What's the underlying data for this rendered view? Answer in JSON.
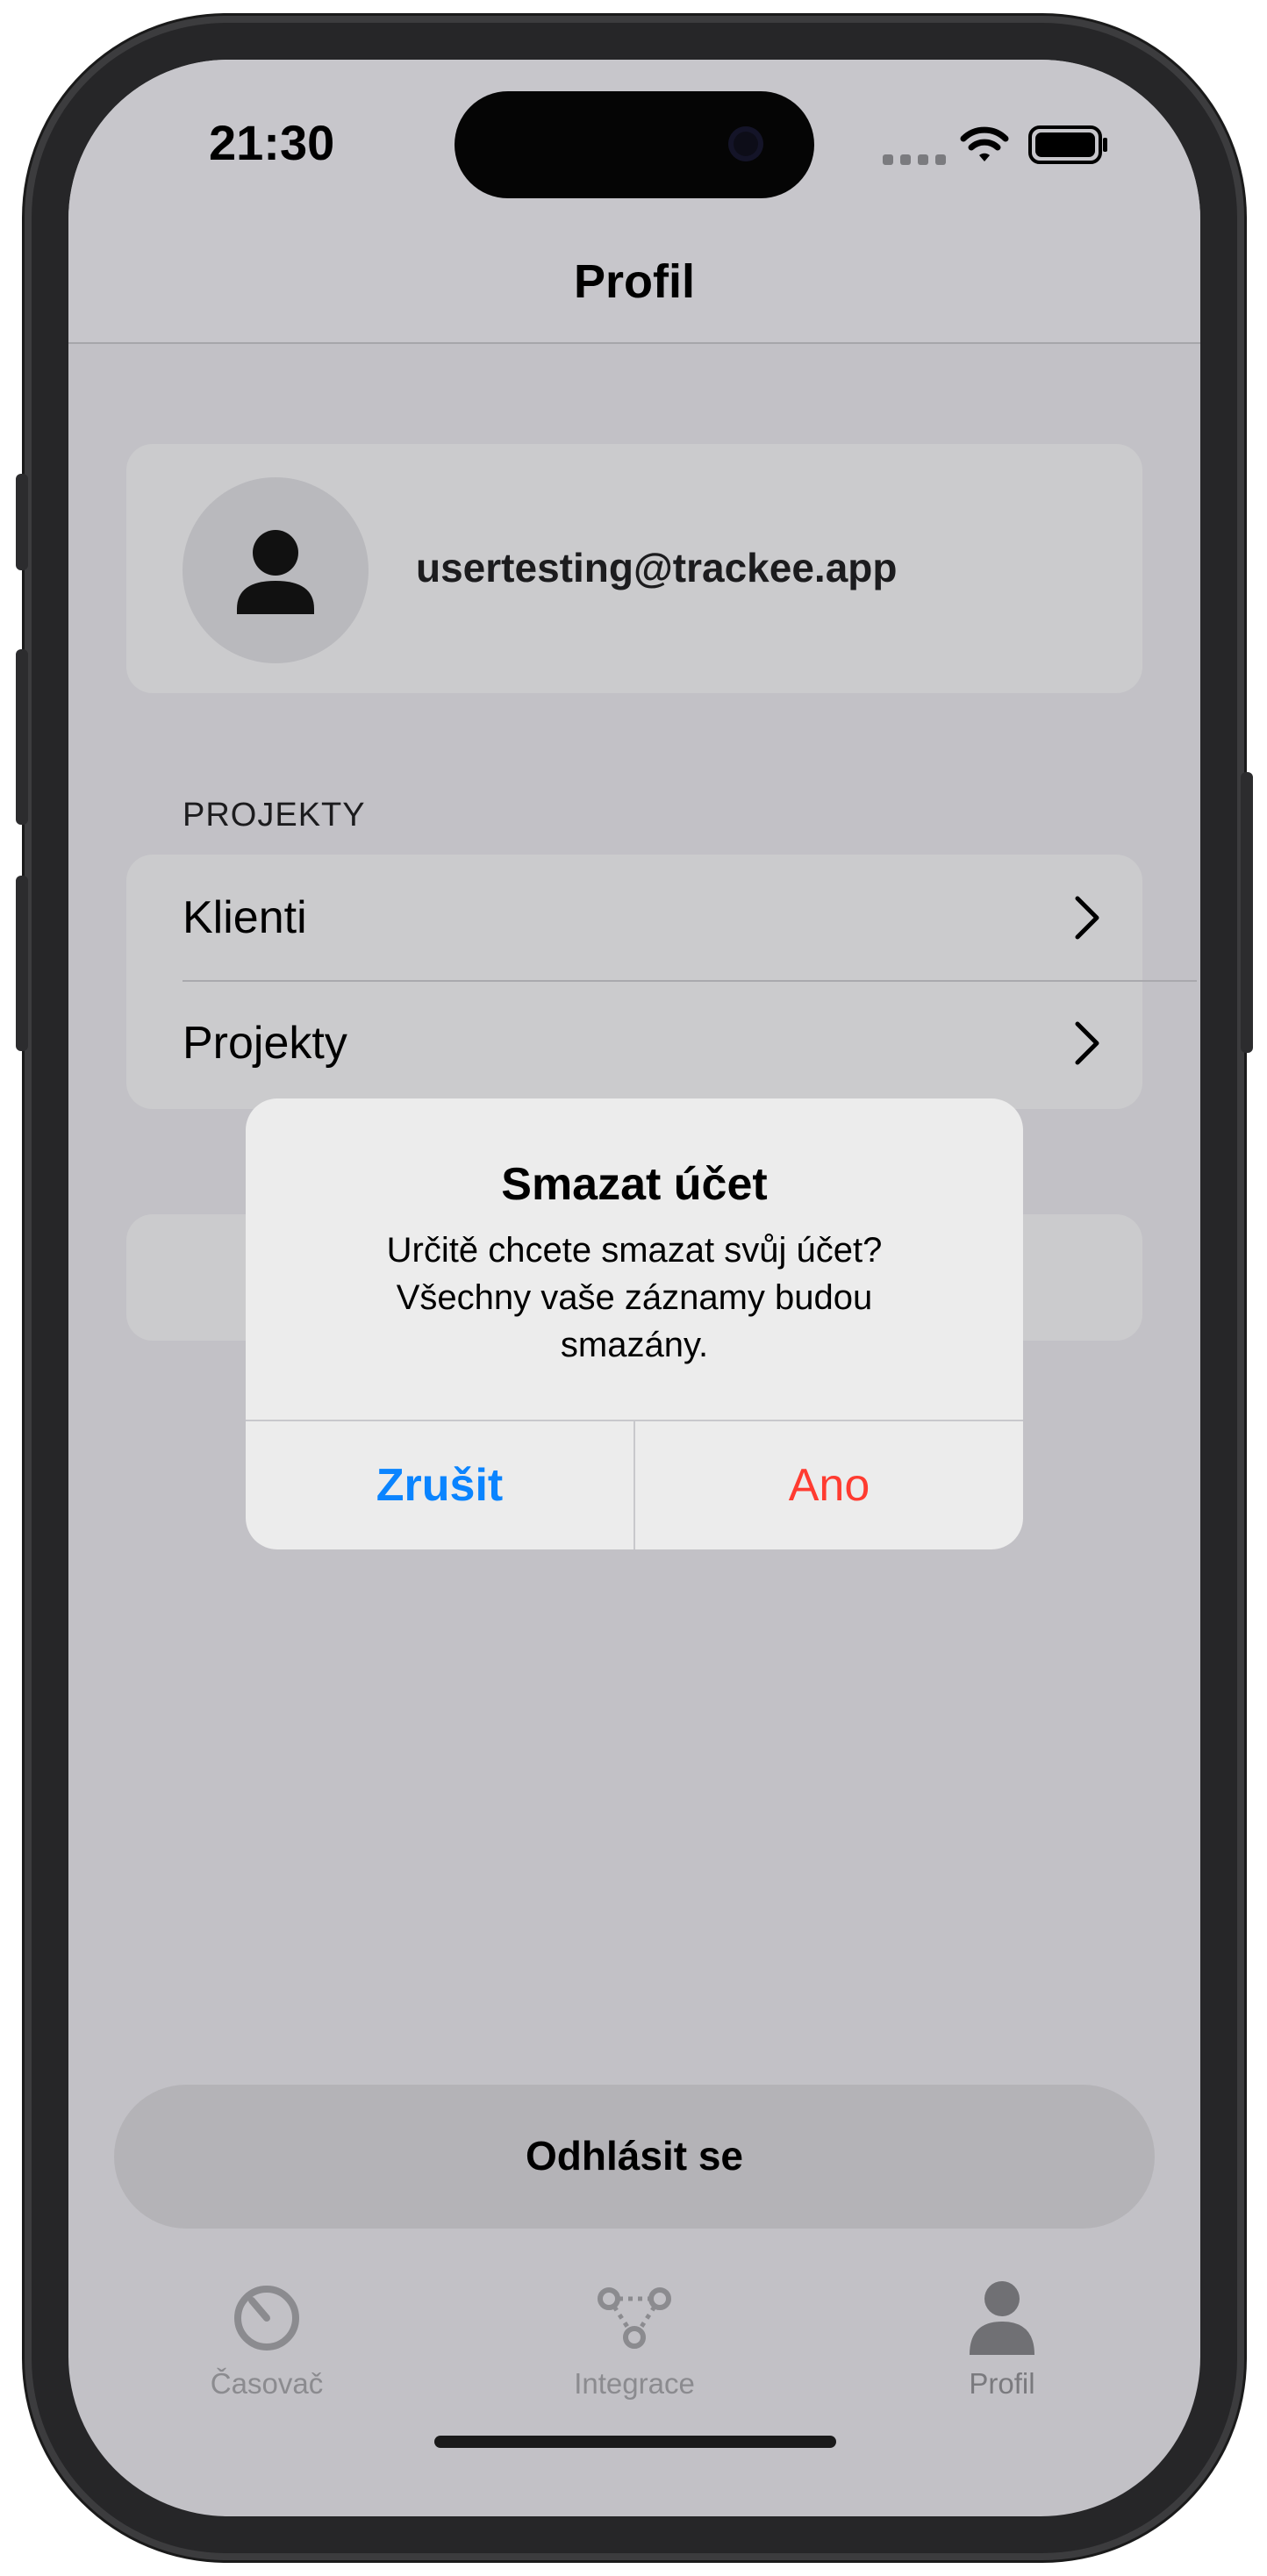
{
  "status_bar": {
    "time": "21:30"
  },
  "nav": {
    "title": "Profil"
  },
  "profile": {
    "email": "usertesting@trackee.app"
  },
  "projects_section": {
    "header": "PROJEKTY",
    "items": [
      {
        "label": "Klienti"
      },
      {
        "label": "Projekty"
      }
    ]
  },
  "logout": {
    "label": "Odhlásit se"
  },
  "tab_bar": {
    "tabs": [
      {
        "label": "Časovač",
        "icon": "timer-icon",
        "active": false
      },
      {
        "label": "Integrace",
        "icon": "integration-icon",
        "active": false
      },
      {
        "label": "Profil",
        "icon": "person-icon",
        "active": true
      }
    ]
  },
  "alert": {
    "title": "Smazat účet",
    "message": "Určitě chcete smazat svůj účet? Všechny vaše záznamy budou smazány.",
    "cancel_label": "Zrušit",
    "confirm_label": "Ano"
  },
  "colors": {
    "cancel": "#0a84ff",
    "destructive": "#ff3b30",
    "dimmed_background": "#c2c1c6"
  }
}
